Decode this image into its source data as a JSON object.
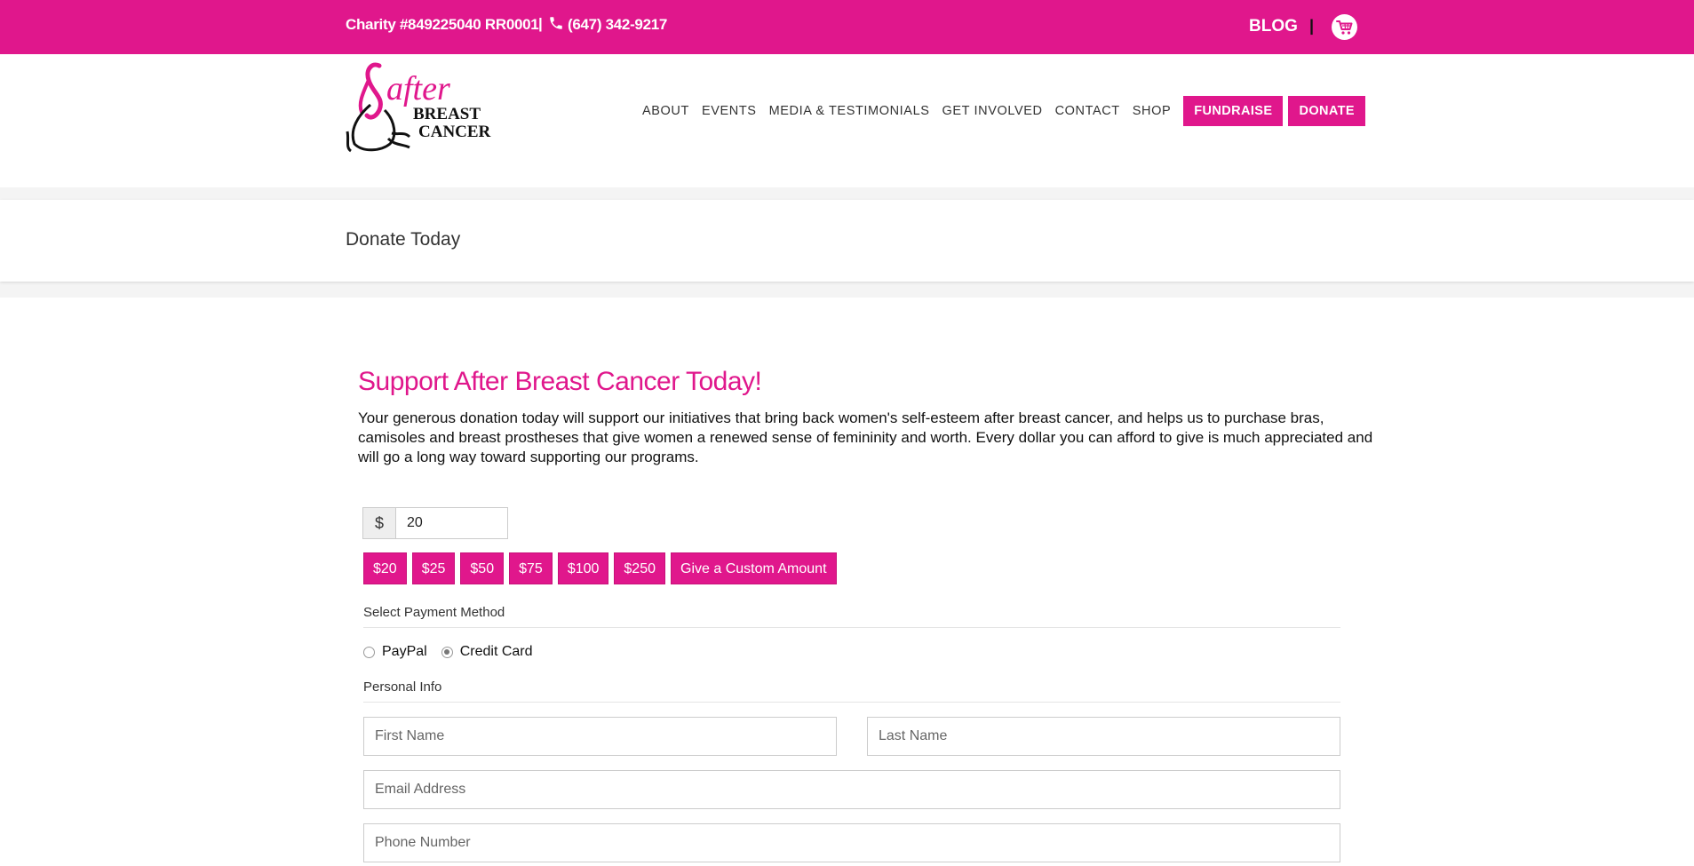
{
  "topbar": {
    "charity": "Charity #849225040 RR0001",
    "separator": "|",
    "phone": "(647) 342-9217",
    "blog_label": "BLOG",
    "right_separator": "|"
  },
  "logo": {
    "line1": "after",
    "line2": "BREAST",
    "line3": "CANCER"
  },
  "nav": {
    "items": [
      "ABOUT",
      "EVENTS",
      "MEDIA & TESTIMONIALS",
      "GET INVOLVED",
      "CONTACT",
      "SHOP"
    ],
    "fundraise_label": "FUNDRAISE",
    "donate_label": "DONATE"
  },
  "page": {
    "title": "Donate Today"
  },
  "form": {
    "heading": "Support After Breast Cancer Today!",
    "intro": "Your generous donation today will support our initiatives that bring back women's self-esteem after breast cancer, and helps us to purchase bras, camisoles and breast prostheses that give women a renewed sense of femininity and worth. Every dollar you can afford to give is much appreciated and will go a long way toward supporting our programs.",
    "currency_symbol": "$",
    "amount_value": "20",
    "presets": [
      "$20",
      "$25",
      "$50",
      "$75",
      "$100",
      "$250"
    ],
    "custom_amount_label": "Give a Custom Amount",
    "payment_section_label": "Select Payment Method",
    "payment_options": [
      "PayPal",
      "Credit Card"
    ],
    "payment_selected": "Credit Card",
    "personal_section_label": "Personal Info",
    "first_name_placeholder": "First Name",
    "last_name_placeholder": "Last Name",
    "email_placeholder": "Email Address",
    "phone_placeholder": "Phone Number"
  },
  "colors": {
    "brand": "#e0178c"
  }
}
